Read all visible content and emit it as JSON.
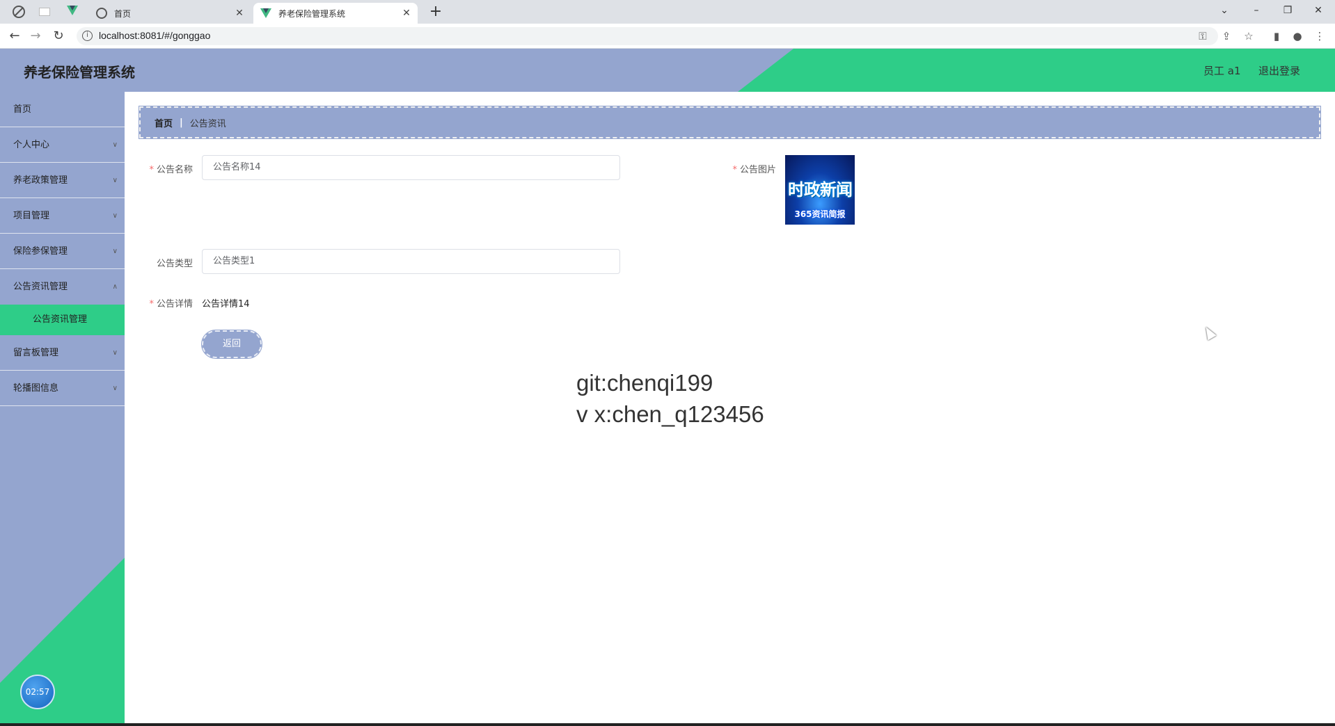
{
  "browser": {
    "tabs": [
      {
        "label": "首页",
        "close": "✕"
      },
      {
        "label": "养老保险管理系统",
        "close": "✕"
      }
    ],
    "new_tab": "+",
    "url": "localhost:8081/#/gonggao",
    "window_controls": {
      "tabsearch": "⌄",
      "minimize": "–",
      "restore": "❐",
      "close": "✕"
    }
  },
  "header": {
    "title": "养老保险管理系统",
    "user": "员工 a1",
    "logout": "退出登录"
  },
  "sidebar": {
    "items": [
      {
        "label": "首页",
        "has_arrow": false
      },
      {
        "label": "个人中心",
        "has_arrow": true
      },
      {
        "label": "养老政策管理",
        "has_arrow": true
      },
      {
        "label": "项目管理",
        "has_arrow": true
      },
      {
        "label": "保险参保管理",
        "has_arrow": true
      },
      {
        "label": "公告资讯管理",
        "has_arrow": true
      },
      {
        "label": "留言板管理",
        "has_arrow": true
      },
      {
        "label": "轮播图信息",
        "has_arrow": true
      }
    ],
    "submenu": {
      "label": "公告资讯管理"
    },
    "clock": "02:57"
  },
  "breadcrumb": {
    "home": "首页",
    "separator": "|",
    "current": "公告资讯"
  },
  "form": {
    "name": {
      "label": "公告名称",
      "value": "公告名称14",
      "required": "*"
    },
    "image": {
      "label": "公告图片",
      "required": "*",
      "image_title": "时政新闻",
      "image_sub": "365资讯简报"
    },
    "type": {
      "label": "公告类型",
      "value": "公告类型1"
    },
    "detail": {
      "label": "公告详情",
      "value": "公告详情14",
      "required": "*"
    },
    "back_button": "返回"
  },
  "watermark": {
    "line1": "git:chenqi199",
    "line2": "v x:chen_q123456"
  },
  "colors": {
    "header_blue": "#94a5cf",
    "accent_green": "#2ecd88",
    "required_red": "#f56c6c"
  }
}
